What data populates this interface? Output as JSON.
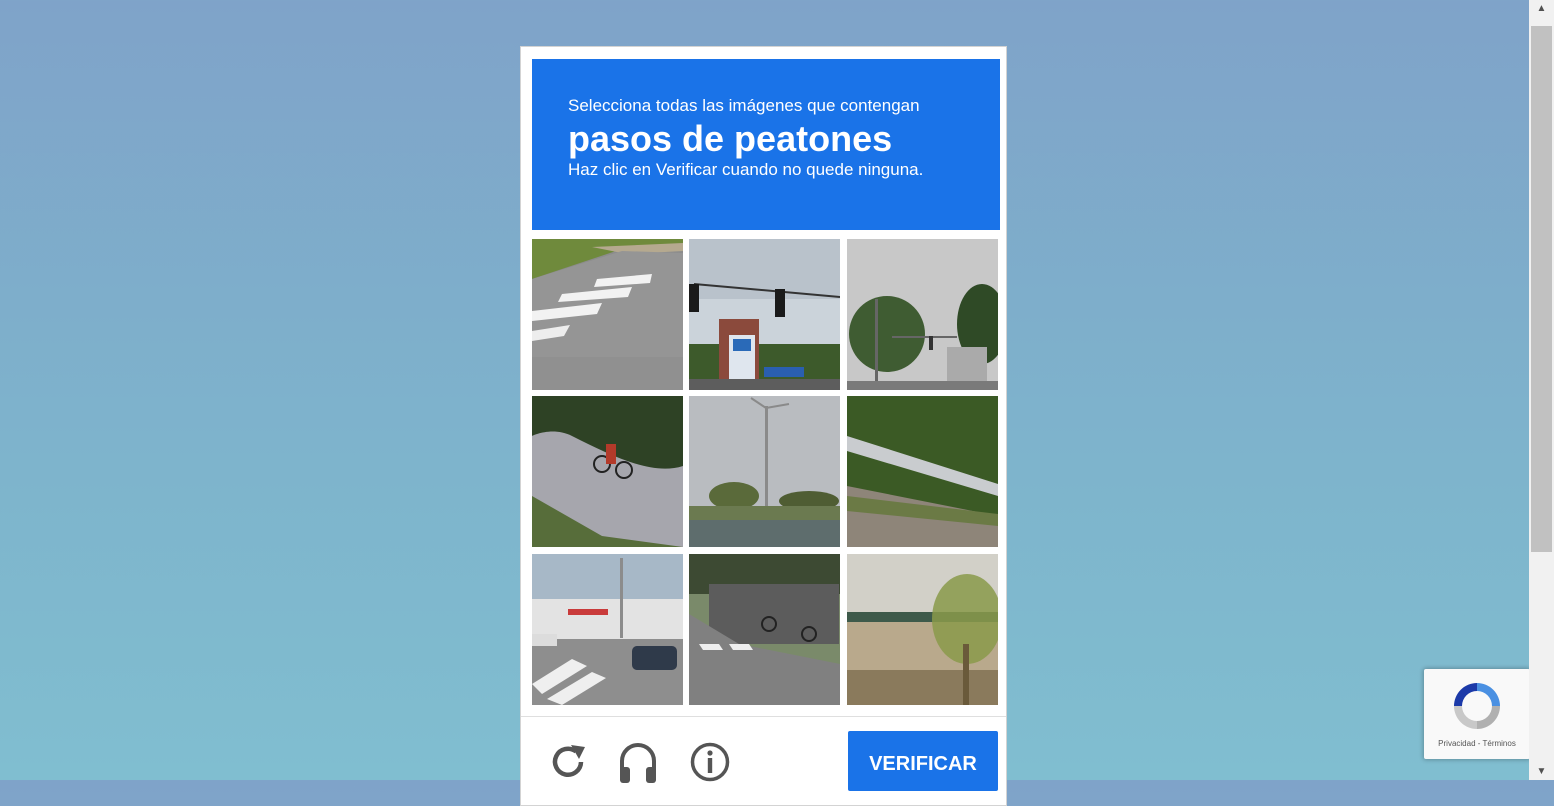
{
  "challenge": {
    "instruction": "Selecciona todas las imágenes que contengan",
    "target": "pasos de peatones",
    "hint": "Haz clic en Verificar cuando no quede ninguna."
  },
  "tiles": [
    {
      "index": 1,
      "scene": "crosswalk-road"
    },
    {
      "index": 2,
      "scene": "traffic-lights-sign"
    },
    {
      "index": 3,
      "scene": "trees-traffic-light"
    },
    {
      "index": 4,
      "scene": "cyclist-path"
    },
    {
      "index": 5,
      "scene": "street-lamp"
    },
    {
      "index": 6,
      "scene": "guardrail-bushes"
    },
    {
      "index": 7,
      "scene": "intersection-crosswalk"
    },
    {
      "index": 8,
      "scene": "bikes-sidewalk"
    },
    {
      "index": 9,
      "scene": "building-palm"
    }
  ],
  "footer": {
    "reload_icon": "reload-icon",
    "audio_icon": "headphones-icon",
    "info_icon": "info-icon",
    "verify_label": "VERIFICAR"
  },
  "badge": {
    "links": "Privacidad - Términos"
  },
  "colors": {
    "accent": "#1a73e8"
  }
}
